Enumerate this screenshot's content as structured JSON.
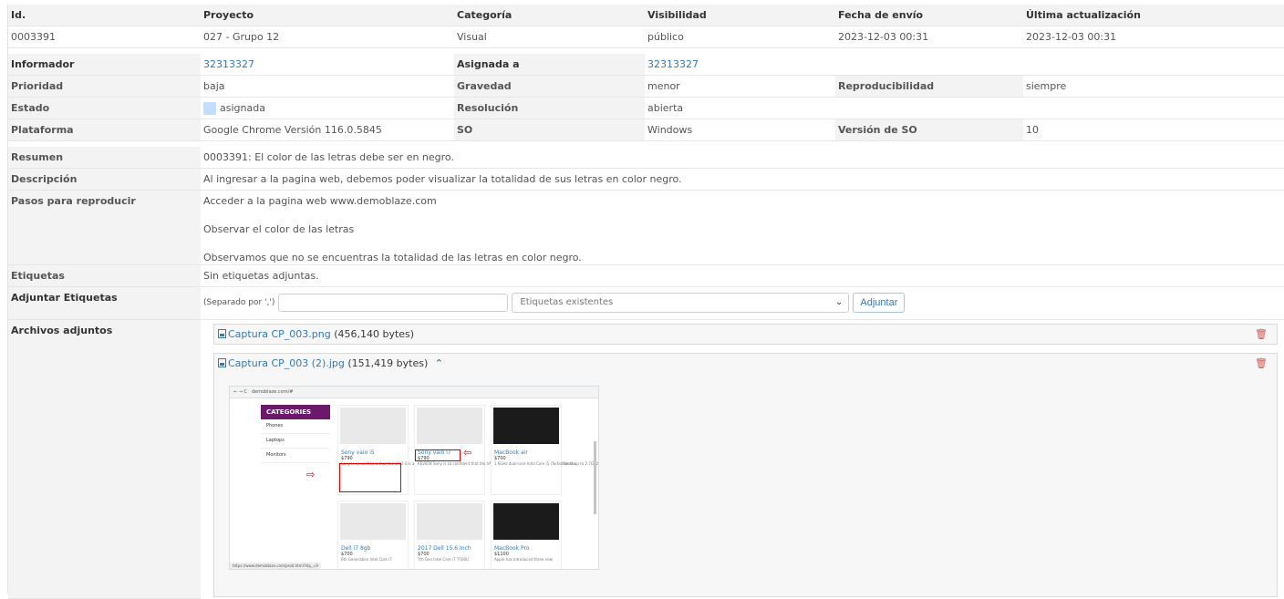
{
  "header": {
    "cols": [
      "Id.",
      "Proyecto",
      "Categoría",
      "Visibilidad",
      "Fecha de envío",
      "Última actualización"
    ],
    "values": [
      "0003391",
      "027 - Grupo 12",
      "Visual",
      "público",
      "2023-12-03 00:31",
      "2023-12-03 00:31"
    ]
  },
  "fields": {
    "informador_label": "Informador",
    "informador": "32313327",
    "asignada_label": "Asignada a",
    "asignada": "32313327",
    "prioridad_label": "Prioridad",
    "prioridad": "baja",
    "gravedad_label": "Gravedad",
    "gravedad": "menor",
    "reproducibilidad_label": "Reproducibilidad",
    "reproducibilidad": "siempre",
    "estado_label": "Estado",
    "estado": "asignada",
    "resolucion_label": "Resolución",
    "resolucion": "abierta",
    "plataforma_label": "Plataforma",
    "plataforma": "Google Chrome Versión 116.0.5845",
    "so_label": "SO",
    "so": "Windows",
    "version_so_label": "Versión de SO",
    "version_so": "10"
  },
  "details": {
    "resumen_label": "Resumen",
    "resumen": "0003391: El color de las letras debe ser en negro.",
    "descripcion_label": "Descripción",
    "descripcion": "Al ingresar a la pagina web, debemos poder visualizar la totalidad de sus letras en color negro.",
    "pasos_label": "Pasos para reproducir",
    "pasos": [
      "Acceder a la pagina web www.demoblaze.com",
      "Observar el color de las letras",
      "Observamos que no se encuentras la totalidad de las letras en color negro."
    ],
    "etiquetas_label": "Etiquetas",
    "etiquetas": "Sin etiquetas adjuntas.",
    "adjuntar_label": "Adjuntar Etiquetas",
    "separador": "(Separado por ',')",
    "tag_input_value": "",
    "existentes": "Etiquetas existentes",
    "adjuntar_button": "Adjuntar",
    "archivos_label": "Archivos adjuntos"
  },
  "attachments": [
    {
      "name": "Captura CP_003.png",
      "size": "(456,140 bytes)"
    },
    {
      "name": "Captura CP_003 (2).jpg",
      "size": "(151,419 bytes)"
    }
  ],
  "preview": {
    "url": "demoblaze.com/#",
    "categories": [
      "CATEGORIES",
      "Phones",
      "Laptops",
      "Monitors"
    ],
    "products": [
      {
        "name": "Sony vaio i5",
        "price": "$790",
        "desc": "Sony is so confident that the VAIO S is a superior ultraportable laptop that the"
      },
      {
        "name": "Sony vaio i7",
        "price": "$790",
        "desc": "REVIEW Sony is so confident that the VAIO S is a superior ultraportable laptop that the"
      },
      {
        "name": "MacBook air",
        "price": "$700",
        "desc": "1.6GHz dual-core Intel Core i5 (Turbo Boost up to 2.7GHz) with 3MB shared L3 cache."
      },
      {
        "name": "Dell i7 8gb",
        "price": "$700",
        "desc": "6th Generation Intel Core i7"
      },
      {
        "name": "2017 Dell 15.6 Inch",
        "price": "$700",
        "desc": "7th Gen Intel Core i7 7500U"
      },
      {
        "name": "MacBook Pro",
        "price": "$1100",
        "desc": "Apple has introduced three new"
      }
    ],
    "status_url": "https://www.demoblaze.com/prod.html?idp_=9"
  }
}
